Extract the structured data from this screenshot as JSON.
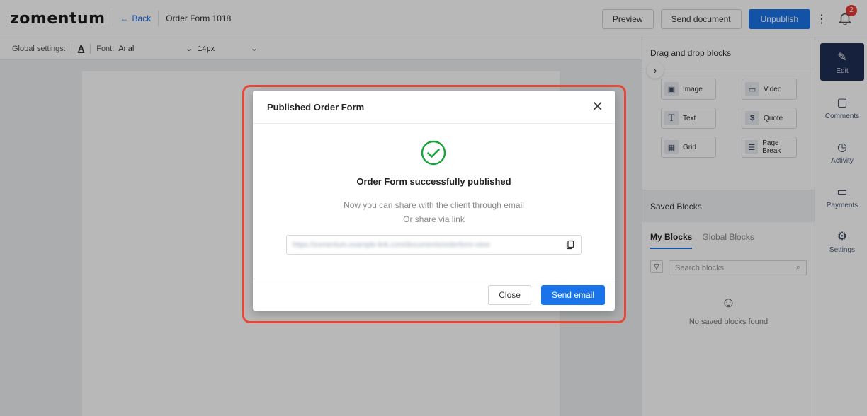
{
  "header": {
    "logo": "zomentum",
    "back_label": "Back",
    "doc_title": "Order Form 1018",
    "preview_label": "Preview",
    "send_document_label": "Send document",
    "unpublish_label": "Unpublish",
    "notification_count": "2"
  },
  "settings": {
    "label": "Global settings:",
    "text_color_letter": "A",
    "font_label": "Font:",
    "font_value": "Arial",
    "size_value": "14px"
  },
  "right_panel": {
    "title": "Drag and drop blocks",
    "blocks": [
      {
        "label": "Image",
        "icon": "image-icon"
      },
      {
        "label": "Video",
        "icon": "video-icon"
      },
      {
        "label": "Text",
        "icon": "text-icon"
      },
      {
        "label": "Quote",
        "icon": "dollar-icon"
      },
      {
        "label": "Grid",
        "icon": "grid-icon"
      },
      {
        "label": "Page Break",
        "icon": "page-break-icon"
      }
    ],
    "saved_blocks_title": "Saved Blocks",
    "tabs": [
      "My Blocks",
      "Global Blocks"
    ],
    "active_tab": "My Blocks",
    "search_placeholder": "Search blocks",
    "empty_message": "No saved blocks found"
  },
  "nav": {
    "items": [
      {
        "label": "Edit",
        "icon": "pen-icon",
        "active": true
      },
      {
        "label": "Comments",
        "icon": "comment-icon"
      },
      {
        "label": "Activity",
        "icon": "clock-icon"
      },
      {
        "label": "Payments",
        "icon": "card-icon"
      },
      {
        "label": "Settings",
        "icon": "gear-icon"
      }
    ]
  },
  "modal": {
    "title": "Published Order Form",
    "success_title": "Order Form successfully published",
    "line1": "Now you can share with the client through email",
    "line2": "Or share via link",
    "link_value": "https://zomentum.example-link.com/documents/orderform-view",
    "close_label": "Close",
    "send_email_label": "Send email"
  },
  "colors": {
    "primary": "#1a73e8",
    "success": "#17a33a",
    "highlight": "#e5483b",
    "nav_active": "#1f2f55"
  }
}
